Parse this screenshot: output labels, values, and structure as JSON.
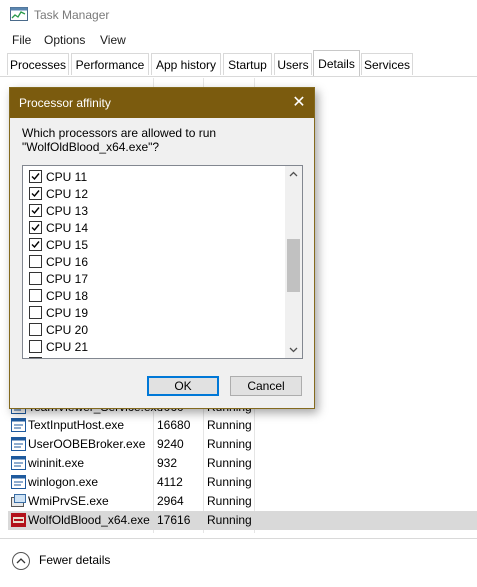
{
  "window": {
    "title": "Task Manager",
    "app_icon": "task-manager-icon"
  },
  "menu": [
    "File",
    "Options",
    "View"
  ],
  "tabs": [
    {
      "label": "Processes",
      "active": false
    },
    {
      "label": "Performance",
      "active": false
    },
    {
      "label": "App history",
      "active": false
    },
    {
      "label": "Startup",
      "active": false
    },
    {
      "label": "Users",
      "active": false
    },
    {
      "label": "Details",
      "active": true
    },
    {
      "label": "Services",
      "active": false
    }
  ],
  "processes": [
    {
      "name": "TeamViewer_Service.exe",
      "pid": "4060",
      "status": "Running",
      "icon": "app-window-icon"
    },
    {
      "name": "TextInputHost.exe",
      "pid": "16680",
      "status": "Running",
      "icon": "app-window-icon"
    },
    {
      "name": "UserOOBEBroker.exe",
      "pid": "9240",
      "status": "Running",
      "icon": "app-window-icon"
    },
    {
      "name": "wininit.exe",
      "pid": "932",
      "status": "Running",
      "icon": "app-window-icon"
    },
    {
      "name": "winlogon.exe",
      "pid": "4112",
      "status": "Running",
      "icon": "app-window-icon"
    },
    {
      "name": "WmiPrvSE.exe",
      "pid": "2964",
      "status": "Running",
      "icon": "wmi-icon"
    },
    {
      "name": "WolfOldBlood_x64.exe",
      "pid": "17616",
      "status": "Running",
      "icon": "wolfenstein-icon",
      "selected": true
    }
  ],
  "dialog": {
    "title": "Processor affinity",
    "prompt": "Which processors are allowed to run\n\"WolfOldBlood_x64.exe\"?",
    "cpus": [
      {
        "label": "CPU 11",
        "checked": true
      },
      {
        "label": "CPU 12",
        "checked": true
      },
      {
        "label": "CPU 13",
        "checked": true
      },
      {
        "label": "CPU 14",
        "checked": true
      },
      {
        "label": "CPU 15",
        "checked": true
      },
      {
        "label": "CPU 16",
        "checked": false
      },
      {
        "label": "CPU 17",
        "checked": false
      },
      {
        "label": "CPU 18",
        "checked": false
      },
      {
        "label": "CPU 19",
        "checked": false
      },
      {
        "label": "CPU 20",
        "checked": false
      },
      {
        "label": "CPU 21",
        "checked": false
      }
    ],
    "ok_label": "OK",
    "cancel_label": "Cancel"
  },
  "footer": {
    "fewer_details": "Fewer details"
  },
  "colors": {
    "dialog_title_bg": "#7b5b0e",
    "selected_row": "#d9d9d9",
    "default_button_border": "#0078d7"
  }
}
